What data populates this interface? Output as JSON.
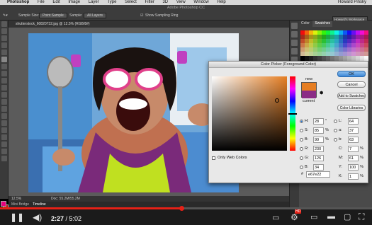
{
  "menubar": {
    "app": "Photoshop",
    "items": [
      "File",
      "Edit",
      "Image",
      "Layer",
      "Type",
      "Select",
      "Filter",
      "3D",
      "View",
      "Window",
      "Help"
    ],
    "user": "Howard Pinsky"
  },
  "window_title": "Adobe Photoshop CC",
  "options": {
    "sample_size_label": "Sample Size:",
    "sample_size_value": "Point Sample",
    "sample_label": "Sample:",
    "sample_value": "All Layers",
    "show_ring_label": "Show Sampling Ring",
    "workspace": "Howard's Workspace"
  },
  "document_tab": "shutterstock_60820732.jpg @ 12.5% (RGB/8#)",
  "status": {
    "zoom": "12.5%",
    "doc": "Doc: 55.2M/55.2M"
  },
  "bottom_tabs": [
    "Mini Bridge",
    "Timeline"
  ],
  "swatches_panel": {
    "tabs": [
      "Color",
      "Swatches"
    ],
    "active": "Swatches"
  },
  "color_picker": {
    "title": "Color Picker (Foreground Color)",
    "new_label": "new",
    "current_label": "current",
    "new_color": "#e67e22",
    "current_color": "#8b2c86",
    "buttons": {
      "ok": "OK",
      "cancel": "Cancel",
      "add": "Add to Swatches",
      "libraries": "Color Libraries"
    },
    "web_only_label": "Only Web Colors",
    "fields": {
      "H": {
        "label": "H:",
        "value": "28",
        "unit": "°"
      },
      "S": {
        "label": "S:",
        "value": "85",
        "unit": "%"
      },
      "Bv": {
        "label": "B:",
        "value": "90",
        "unit": "%"
      },
      "R": {
        "label": "R:",
        "value": "230"
      },
      "G": {
        "label": "G:",
        "value": "126"
      },
      "Bc": {
        "label": "B:",
        "value": "34"
      },
      "L": {
        "label": "L:",
        "value": "64"
      },
      "a": {
        "label": "a:",
        "value": "37"
      },
      "b": {
        "label": "b:",
        "value": "63"
      },
      "C": {
        "label": "C:",
        "value": "7",
        "unit": "%"
      },
      "M": {
        "label": "M:",
        "value": "61",
        "unit": "%"
      },
      "Y": {
        "label": "Y:",
        "value": "100",
        "unit": "%"
      },
      "K": {
        "label": "K:",
        "value": "1",
        "unit": "%"
      }
    },
    "hex_label": "#",
    "hex": "e67e22"
  },
  "player": {
    "current": "2:27",
    "total": "5:02",
    "progress": 0.487,
    "hd_badge": "HD"
  }
}
